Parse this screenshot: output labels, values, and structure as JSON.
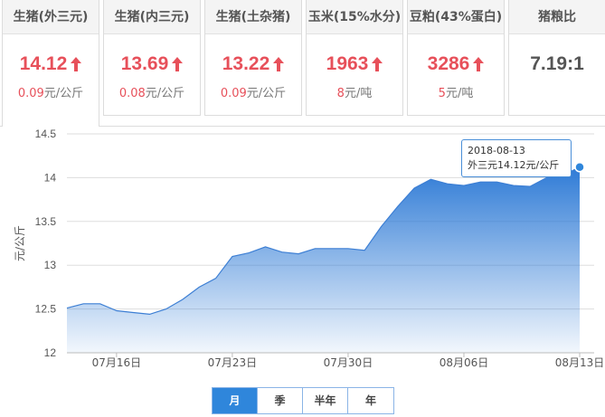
{
  "cards": [
    {
      "label": "生猪(外三元)",
      "price": "14.12",
      "arrow": "up",
      "delta": "0.09",
      "unit": "元/公斤",
      "active": true
    },
    {
      "label": "生猪(内三元)",
      "price": "13.69",
      "arrow": "up",
      "delta": "0.08",
      "unit": "元/公斤",
      "active": false
    },
    {
      "label": "生猪(土杂猪)",
      "price": "13.22",
      "arrow": "up",
      "delta": "0.09",
      "unit": "元/公斤",
      "active": false
    },
    {
      "label": "玉米(15%水分)",
      "price": "1963",
      "arrow": "up",
      "delta": "8",
      "unit": "元/吨",
      "active": false
    },
    {
      "label": "豆粕(43%蛋白)",
      "price": "3286",
      "arrow": "up",
      "delta": "5",
      "unit": "元/吨",
      "active": false
    },
    {
      "label": "猪粮比",
      "price": "7.19:1",
      "arrow": null,
      "delta": "",
      "unit": "",
      "active": false
    }
  ],
  "colors": {
    "up": "#e7505a",
    "fill_top": "#2f7bd6",
    "line": "#3d7fd4",
    "grid": "#dddddd"
  },
  "tooltip": {
    "date": "2018-08-13",
    "series_label": "外三元",
    "value": "14.12",
    "unit": "元/公斤"
  },
  "range_buttons": [
    {
      "label": "月",
      "selected": true
    },
    {
      "label": "季",
      "selected": false
    },
    {
      "label": "半年",
      "selected": false
    },
    {
      "label": "年",
      "selected": false
    }
  ],
  "chart_data": {
    "type": "area",
    "title": "",
    "xlabel": "",
    "ylabel": "元/公斤",
    "ylim": [
      12,
      14.5
    ],
    "yticks": [
      12,
      12.5,
      13,
      13.5,
      14,
      14.5
    ],
    "xlim": [
      "2018-07-13",
      "2018-08-13"
    ],
    "xticks": [
      {
        "date": "2018-07-16",
        "label": "07月16日"
      },
      {
        "date": "2018-07-23",
        "label": "07月23日"
      },
      {
        "date": "2018-07-30",
        "label": "07月30日"
      },
      {
        "date": "2018-08-06",
        "label": "08月06日"
      },
      {
        "date": "2018-08-13",
        "label": "08月13日"
      }
    ],
    "grid": true,
    "series": [
      {
        "name": "外三元",
        "points": [
          [
            "2018-07-13",
            12.51
          ],
          [
            "2018-07-14",
            12.56
          ],
          [
            "2018-07-15",
            12.56
          ],
          [
            "2018-07-16",
            12.48
          ],
          [
            "2018-07-17",
            12.46
          ],
          [
            "2018-07-18",
            12.44
          ],
          [
            "2018-07-19",
            12.5
          ],
          [
            "2018-07-20",
            12.61
          ],
          [
            "2018-07-21",
            12.75
          ],
          [
            "2018-07-22",
            12.85
          ],
          [
            "2018-07-23",
            13.1
          ],
          [
            "2018-07-24",
            13.14
          ],
          [
            "2018-07-25",
            13.21
          ],
          [
            "2018-07-26",
            13.15
          ],
          [
            "2018-07-27",
            13.13
          ],
          [
            "2018-07-28",
            13.19
          ],
          [
            "2018-07-29",
            13.19
          ],
          [
            "2018-07-30",
            13.19
          ],
          [
            "2018-07-31",
            13.17
          ],
          [
            "2018-08-01",
            13.44
          ],
          [
            "2018-08-02",
            13.67
          ],
          [
            "2018-08-03",
            13.88
          ],
          [
            "2018-08-04",
            13.98
          ],
          [
            "2018-08-05",
            13.93
          ],
          [
            "2018-08-06",
            13.91
          ],
          [
            "2018-08-07",
            13.95
          ],
          [
            "2018-08-08",
            13.95
          ],
          [
            "2018-08-09",
            13.91
          ],
          [
            "2018-08-10",
            13.9
          ],
          [
            "2018-08-11",
            14.0
          ],
          [
            "2018-08-12",
            14.03
          ],
          [
            "2018-08-13",
            14.12
          ]
        ]
      }
    ]
  }
}
